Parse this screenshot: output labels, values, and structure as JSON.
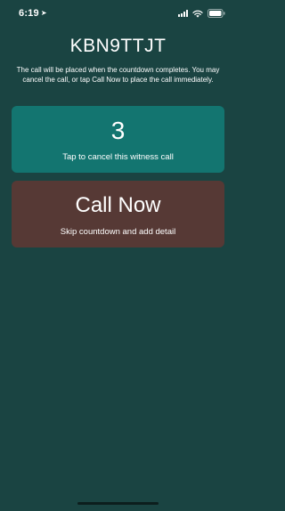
{
  "status_bar": {
    "time": "6:19",
    "location_icon": "location-arrow-icon",
    "signal_icon": "cellular-signal-icon",
    "wifi_icon": "wifi-icon",
    "battery_icon": "battery-icon"
  },
  "header": {
    "callsign": "KBN9TTJT",
    "instructions": "The call will be placed when the countdown completes. You may cancel the call, or tap Call Now to place the call immediately."
  },
  "countdown": {
    "value": "3",
    "subtitle": "Tap to cancel this witness call"
  },
  "call_now": {
    "title": "Call Now",
    "subtitle": "Skip countdown and add detail"
  },
  "colors": {
    "background": "#1a4442",
    "countdown_card": "#137570",
    "call_now_card": "#563935",
    "text": "#ffffff"
  }
}
